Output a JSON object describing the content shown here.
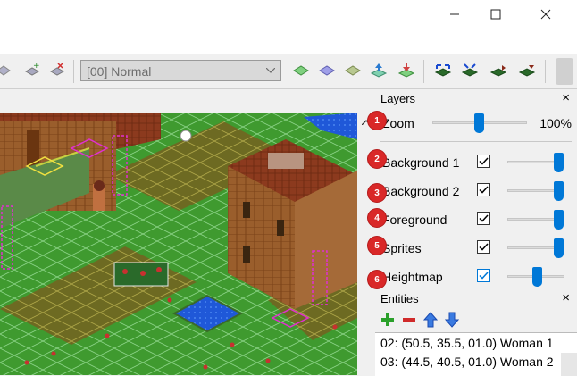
{
  "window": {
    "minimize_icon": "minimize-icon",
    "maximize_icon": "maximize-icon",
    "close_icon": "close-icon"
  },
  "toolbar": {
    "layer_select_value": "[00] Normal",
    "icons": [
      "tile-add-icon",
      "tile-remove-icon",
      "diamond-green-icon",
      "diamond-purple-icon",
      "diamond-olive-icon",
      "raise-icon",
      "lower-icon",
      "expand-arrows-icon",
      "compress-arrows-icon",
      "tile-shift-right-icon",
      "tile-shift-down-icon"
    ]
  },
  "layers": {
    "title": "Layers",
    "close": "×",
    "zoom": {
      "label": "Zoom",
      "value": "100%"
    },
    "items": [
      {
        "label": "Background 1",
        "checked": true
      },
      {
        "label": "Background 2",
        "checked": true
      },
      {
        "label": "Foreground",
        "checked": true
      },
      {
        "label": "Sprites",
        "checked": true
      },
      {
        "label": "Heightmap",
        "checked": true
      }
    ]
  },
  "badges": [
    "1",
    "2",
    "3",
    "4",
    "5",
    "6"
  ],
  "entities": {
    "title": "Entities",
    "close": "×",
    "rows": [
      "02: (50.5, 35.5, 01.0) Woman 1",
      "03: (44.5, 40.5, 01.0) Woman 2"
    ]
  },
  "colors": {
    "accent": "#0078d7",
    "badge": "#d92828"
  }
}
